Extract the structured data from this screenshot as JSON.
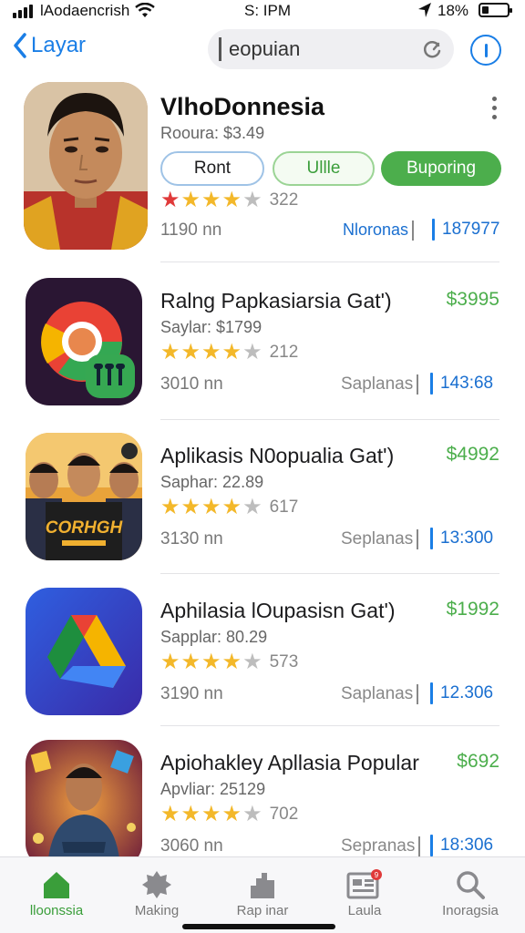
{
  "status_bar": {
    "carrier": "lAodaencrish",
    "time": "S: IPM",
    "battery": "18%"
  },
  "nav": {
    "back_label": "Layar",
    "search_value": "eopuian"
  },
  "featured": {
    "title": "VlhoDonnesia",
    "subtitle": "Rooura: $3.49",
    "buttons": [
      "Ront",
      "Ullle",
      "Buporing"
    ],
    "rating": 4,
    "rating_count": "322",
    "meta_left": "1190 nn",
    "meta_mid": "Nloronas",
    "meta_right": "187977"
  },
  "list": [
    {
      "title": "Ralng Papkasiarsia Gat')",
      "price": "$3995",
      "subtitle": "Saylar: $1799",
      "rating": 4,
      "rating_count": "212",
      "meta_left": "3010 nn",
      "meta_mid": "Saplanas",
      "meta_right": "143:68"
    },
    {
      "title": "Aplikasis N0opualia Gat')",
      "price": "$4992",
      "subtitle": "Saphar: 22.89",
      "rating": 4,
      "rating_count": "617",
      "meta_left": "3130 nn",
      "meta_mid": "Seplanas",
      "meta_right": "13:300"
    },
    {
      "title": "Aphilasia lOupasisn Gat')",
      "price": "$1992",
      "subtitle": "Sapplar: 80.29",
      "rating": 4,
      "rating_count": "573",
      "meta_left": "3190 nn",
      "meta_mid": "Saplanas",
      "meta_right": "12.306"
    },
    {
      "title": "Apiohakley Apllasia Popular",
      "price": "$692",
      "subtitle": "Apvliar: 25129",
      "rating": 4,
      "rating_count": "702",
      "meta_left": "3060 nn",
      "meta_mid": "Sepranas",
      "meta_right": "18:306"
    }
  ],
  "tabs": [
    "lloonssia",
    "Making",
    "Rap inar",
    "Laula",
    "Inoragsia"
  ],
  "colors": {
    "accent_blue": "#1a7ee6",
    "accent_green": "#4cae4c",
    "star_gold": "#f3b82a"
  }
}
